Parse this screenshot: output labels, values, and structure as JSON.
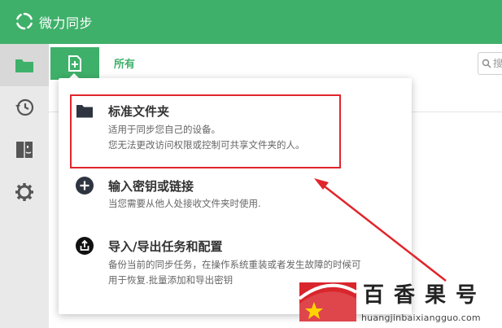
{
  "app": {
    "title": "微力同步"
  },
  "toolbar": {
    "tab_all": "所有",
    "search_placeholder": "搜"
  },
  "menu": {
    "items": [
      {
        "label": "标准文件夹",
        "desc_line1": "适用于同步您自己的设备。",
        "desc_line2": "您无法更改访问权限或控制可共享文件夹的人。",
        "icon": "folder-icon"
      },
      {
        "label": "输入密钥或链接",
        "desc_line1": "当您需要从他人处接收文件夹时使用.",
        "icon": "plus-circle-icon"
      },
      {
        "label": "导入/导出任务和配置",
        "desc_line1": "备份当前的同步任务，在操作系统重装或者发生故障的时候可",
        "desc_line2": "用于恢复.批量添加和导出密钥",
        "icon": "share-icon"
      }
    ]
  },
  "watermark": {
    "chars": [
      "百",
      "香",
      "果",
      "号"
    ],
    "url": "huangjinbaixiangguo.com"
  },
  "colors": {
    "brand": "#3fb06a",
    "highlight": "#e0252b",
    "sidebar": "#e9e9e9"
  }
}
